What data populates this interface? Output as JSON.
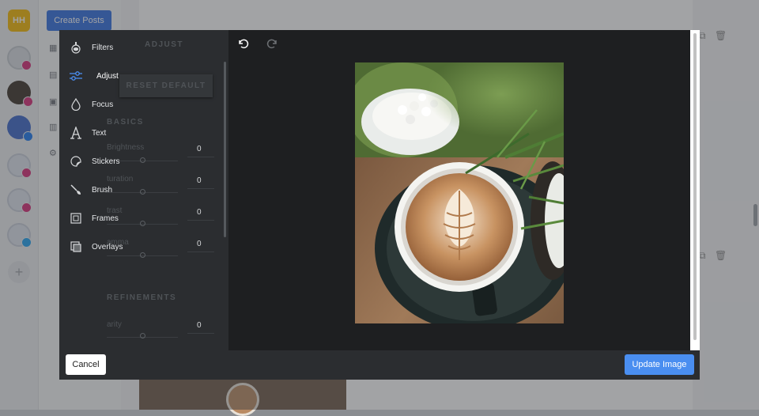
{
  "app": {
    "workspace_initials": "HH",
    "create_posts_label": "Create Posts"
  },
  "editor": {
    "tools": [
      {
        "label": "Filters",
        "icon": "filters-icon"
      },
      {
        "label": "Adjust",
        "icon": "sliders-icon",
        "active": true
      },
      {
        "label": "Focus",
        "icon": "drop-icon"
      },
      {
        "label": "Text",
        "icon": "text-icon"
      },
      {
        "label": "Stickers",
        "icon": "sticker-icon"
      },
      {
        "label": "Brush",
        "icon": "brush-icon"
      },
      {
        "label": "Frames",
        "icon": "frame-icon"
      },
      {
        "label": "Overlays",
        "icon": "overlay-icon"
      }
    ],
    "adjust_panel": {
      "title": "ADJUST",
      "reset_label": "RESET DEFAULT",
      "basics_heading": "BASICS",
      "basics": [
        {
          "name": "Brightness",
          "visible_text": "Brightness",
          "value": "0"
        },
        {
          "name": "Saturation",
          "visible_text": "turation",
          "value": "0"
        },
        {
          "name": "Contrast",
          "visible_text": "trast",
          "value": "0"
        },
        {
          "name": "Gamma",
          "visible_text": "amma",
          "value": "0"
        }
      ],
      "refinements_heading": "REFINEMENTS",
      "refinements": [
        {
          "name": "Clarity",
          "visible_text": "arity",
          "value": "0"
        }
      ]
    },
    "cancel_label": "Cancel",
    "update_label": "Update Image",
    "colors": {
      "accent": "#4a8ef0",
      "active_icon": "#4a8ef0",
      "workspace_badge": "#f5b800"
    }
  }
}
